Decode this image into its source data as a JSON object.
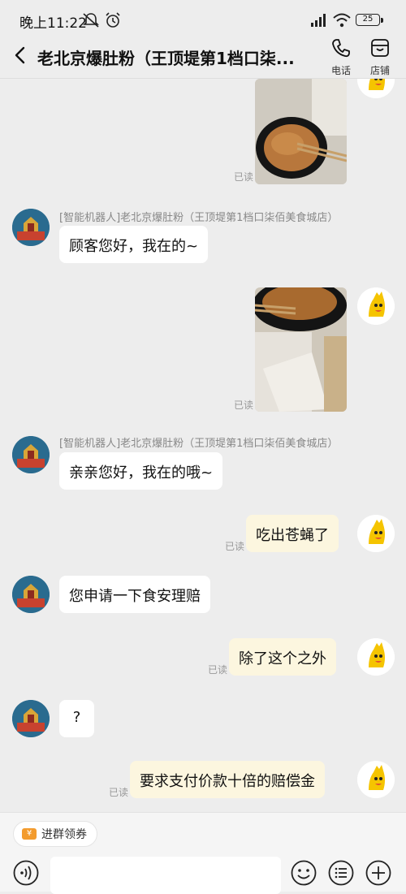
{
  "status": {
    "time": "晚上11:22",
    "battery": "25"
  },
  "header": {
    "title": "老北京爆肚粉（王顶堤第1档口柒...",
    "phone_label": "电话",
    "store_label": "店铺"
  },
  "shop_avatar_text": "老北京爆肚粉",
  "messages": {
    "read_label": "已读",
    "sender": "[智能机器人]老北京爆肚粉（王顶堤第1档口柒佰美食城店）",
    "bot1": "顾客您好，我在的~",
    "bot2": "亲亲您好，我在的哦~",
    "user1": "吃出苍蝇了",
    "bot3": "您申请一下食安理赔",
    "user2": "除了这个之外",
    "bot4": "?",
    "user3": "要求支付价款十倍的赔偿金"
  },
  "bottom": {
    "coupon_label": "进群领券",
    "input_value": ""
  },
  "colors": {
    "bg": "#ededed",
    "user_bubble": "#fcf6df",
    "bot_bubble": "#ffffff",
    "accent": "#f39b2d"
  }
}
